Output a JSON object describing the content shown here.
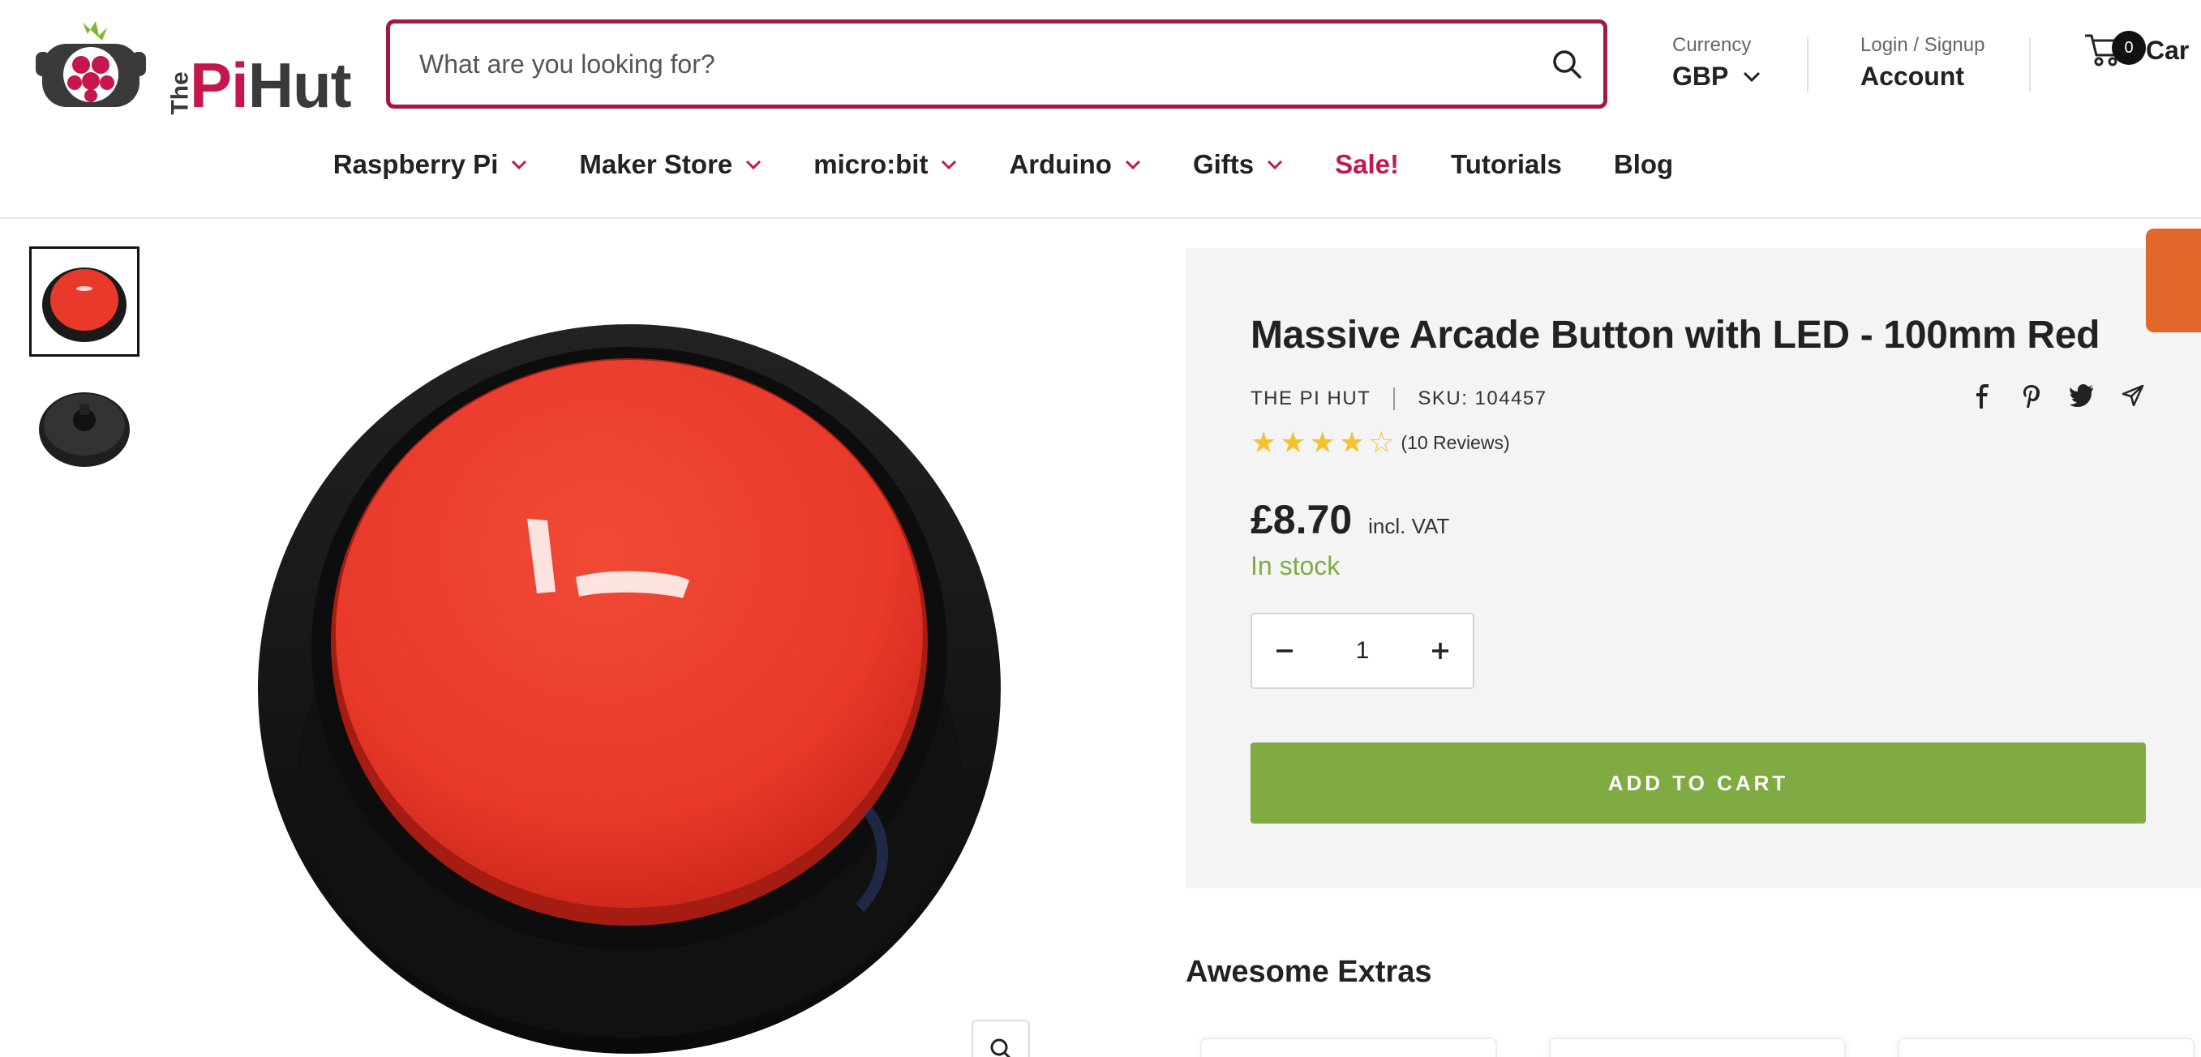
{
  "brand": {
    "logo_the": "The",
    "logo_pi": "Pi",
    "logo_hut": "Hut"
  },
  "search": {
    "placeholder": "What are you looking for?"
  },
  "currency": {
    "label": "Currency",
    "value": "GBP"
  },
  "account": {
    "label": "Login / Signup",
    "value": "Account"
  },
  "cart": {
    "count": "0",
    "label": "Car"
  },
  "nav": [
    {
      "label": "Raspberry Pi",
      "has_dropdown": true
    },
    {
      "label": "Maker Store",
      "has_dropdown": true
    },
    {
      "label": "micro:bit",
      "has_dropdown": true
    },
    {
      "label": "Arduino",
      "has_dropdown": true
    },
    {
      "label": "Gifts",
      "has_dropdown": true
    },
    {
      "label": "Sale!",
      "has_dropdown": false
    },
    {
      "label": "Tutorials",
      "has_dropdown": false
    },
    {
      "label": "Blog",
      "has_dropdown": false
    }
  ],
  "product": {
    "title": "Massive Arcade Button with LED - 100mm Red",
    "vendor": "THE PI HUT",
    "sku": "SKU: 104457",
    "rating_value": 4.5,
    "rating_max": 5,
    "reviews": "(10 Reviews)",
    "price": "£8.70",
    "vat": "incl. VAT",
    "stock": "In stock",
    "quantity": "1",
    "add_to_cart": "ADD TO CART"
  },
  "share_icons": [
    "facebook-icon",
    "pinterest-icon",
    "twitter-icon",
    "send-icon"
  ],
  "extras": {
    "title": "Awesome Extras"
  },
  "colors": {
    "brand": "#c5174b",
    "search_border": "#a3183f",
    "stock": "#7fac42",
    "cta": "#7fab42",
    "star": "#f4c430",
    "side_tab": "#e2672a",
    "button_red": "#e8392a"
  }
}
